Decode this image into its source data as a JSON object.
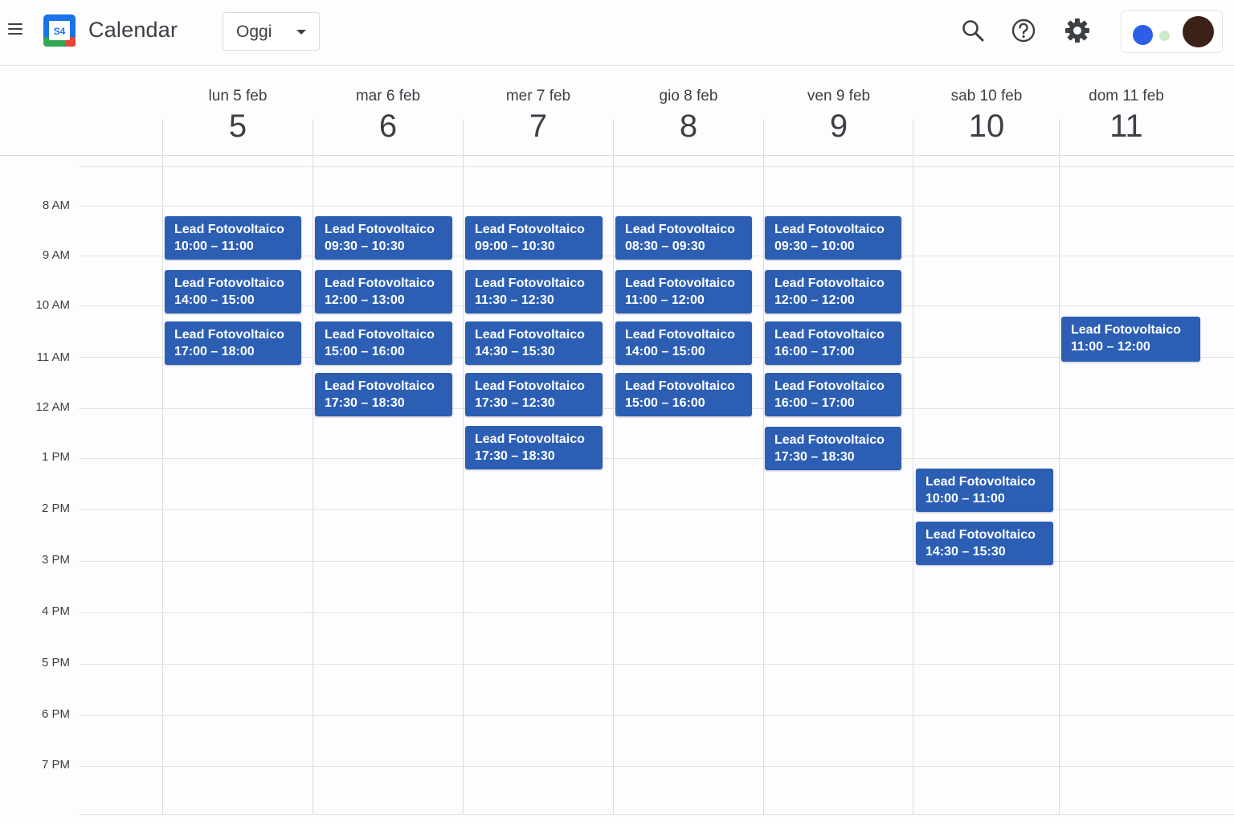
{
  "header": {
    "menu_icon": "hamburger-menu-icon",
    "logo_icon": "calendar-logo-icon",
    "logo_text": "S4",
    "app_title": "Calendar",
    "today_select": "Oggi",
    "search_icon": "search-icon",
    "help_icon": "help-icon",
    "settings_icon": "gear-icon"
  },
  "colors": {
    "event_bg": "#2c5fb4",
    "account_dot_blue": "#2e5ee8",
    "account_dot_green": "#cdebc9"
  },
  "days": [
    {
      "name": "lun 5 feb",
      "num": "5"
    },
    {
      "name": "mar 6 feb",
      "num": "6"
    },
    {
      "name": "mer 7 feb",
      "num": "7"
    },
    {
      "name": "gio 8 feb",
      "num": "8"
    },
    {
      "name": "ven 9 feb",
      "num": "9"
    },
    {
      "name": "sab 10 feb",
      "num": "10"
    },
    {
      "name": "dom 11 feb",
      "num": "11"
    }
  ],
  "hours": [
    "8 AM",
    "9 AM",
    "10 AM",
    "11 AM",
    "12 AM",
    "1 PM",
    "2 PM",
    "3 PM",
    "4 PM",
    "5 PM",
    "6 PM",
    "7 PM"
  ],
  "event_title": "Lead Fotovoltaico",
  "events": [
    {
      "day": 0,
      "time": "10:00 – 11:00"
    },
    {
      "day": 0,
      "time": "14:00 – 15:00"
    },
    {
      "day": 0,
      "time": "17:00 – 18:00"
    },
    {
      "day": 1,
      "time": "09:30 – 10:30"
    },
    {
      "day": 1,
      "time": "12:00 – 13:00"
    },
    {
      "day": 1,
      "time": "15:00 – 16:00"
    },
    {
      "day": 1,
      "time": "17:30 – 18:30"
    },
    {
      "day": 2,
      "time": "09:00 – 10:30"
    },
    {
      "day": 2,
      "time": "11:30 – 12:30"
    },
    {
      "day": 2,
      "time": "14:30 – 15:30"
    },
    {
      "day": 2,
      "time": "17:30 – 12:30"
    },
    {
      "day": 2,
      "time": "17:30 – 18:30"
    },
    {
      "day": 3,
      "time": "08:30 – 09:30"
    },
    {
      "day": 3,
      "time": "11:00 – 12:00"
    },
    {
      "day": 3,
      "time": "14:00 – 15:00"
    },
    {
      "day": 3,
      "time": "15:00 – 16:00"
    },
    {
      "day": 4,
      "time": "09:30 – 10:00"
    },
    {
      "day": 4,
      "time": "12:00 – 12:00"
    },
    {
      "day": 4,
      "time": "16:00 – 17:00"
    },
    {
      "day": 4,
      "time": "16:00 – 17:00"
    },
    {
      "day": 4,
      "time": "17:30 – 18:30"
    },
    {
      "day": 5,
      "time": "10:00 – 11:00"
    },
    {
      "day": 5,
      "time": "14:30 – 15:30"
    },
    {
      "day": 6,
      "time": "11:00 – 12:00"
    }
  ]
}
